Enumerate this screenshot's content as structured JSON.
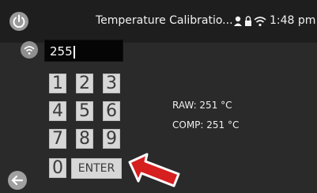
{
  "header": {
    "title": "Temperature Calibratio...",
    "time": "1:48 pm",
    "icons": [
      "power-icon",
      "user-icon",
      "lock-icon",
      "wifi-icon"
    ]
  },
  "input": {
    "value": "255",
    "wifi_icon": "wifi-icon"
  },
  "keypad": {
    "keys": [
      "1",
      "2",
      "3",
      "4",
      "5",
      "6",
      "7",
      "8",
      "9",
      "0"
    ],
    "enter_label": "ENTER"
  },
  "readings": {
    "raw": "RAW: 251 °C",
    "comp": "COMP: 251 °C"
  },
  "footer": {
    "back_icon": "arrow-left-icon"
  },
  "annotation": {
    "arrow_icon": "arrow-pointer-icon",
    "arrow_color": "#d61f1f"
  },
  "colors": {
    "background": "#2a2a2a",
    "topbar": "#1e1e1e",
    "key_bg": "#d7d7d7",
    "input_bg": "#050505"
  }
}
